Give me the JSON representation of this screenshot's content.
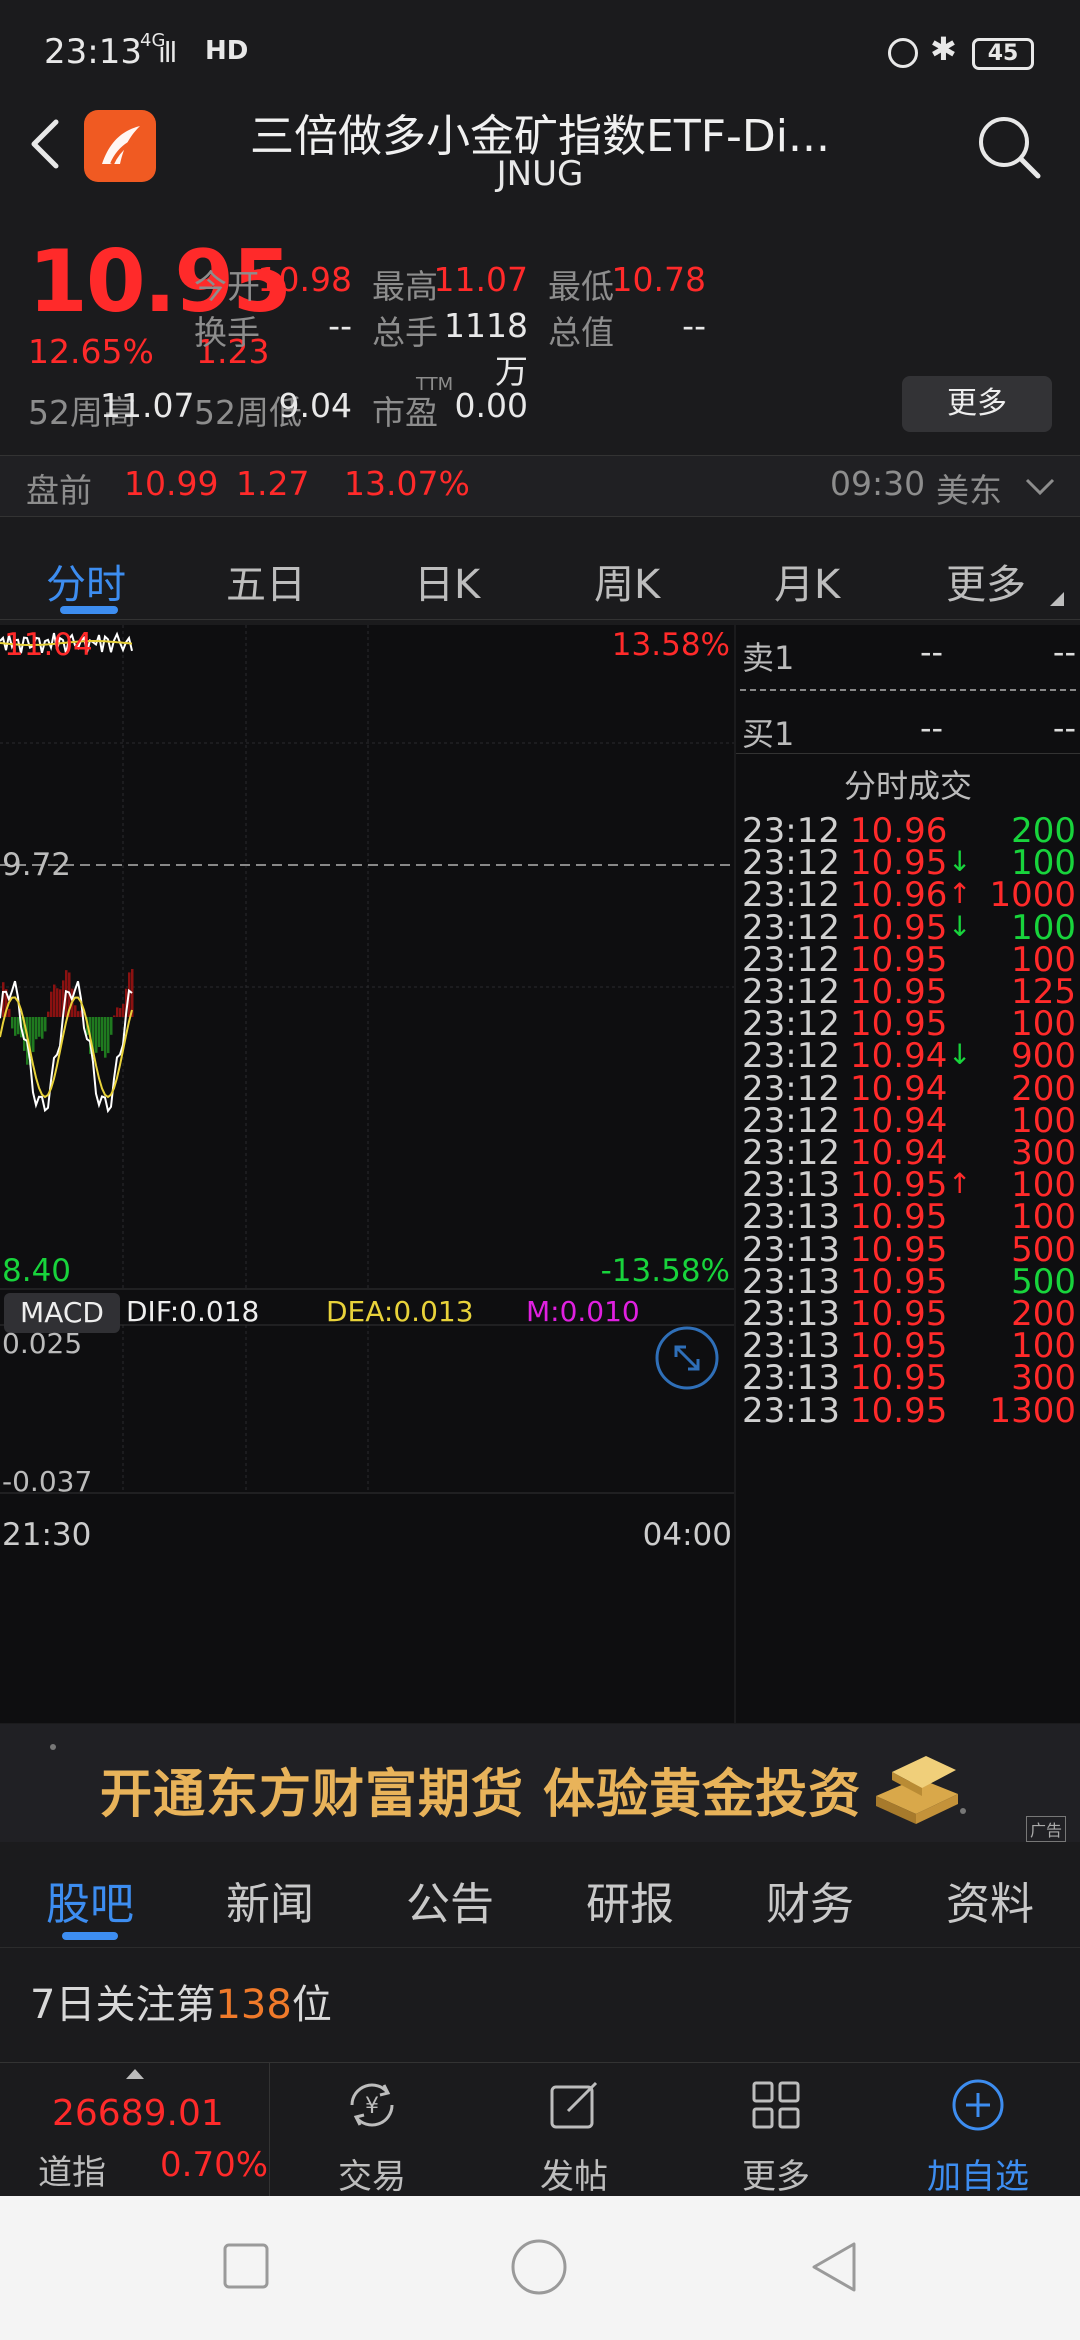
{
  "status_bar": {
    "time": "23:13",
    "network": "4G",
    "signal": "ıll",
    "hd": "HD",
    "battery": "45"
  },
  "header": {
    "title": "三倍做多小金矿指数ETF-Di...",
    "symbol": "JNUG"
  },
  "quote": {
    "price": "10.95",
    "change_pct": "12.65%",
    "change": "1.23",
    "rows": [
      [
        {
          "label": "今开",
          "value": "10.98",
          "color": "#ff2a2a"
        },
        {
          "label": "最高",
          "value": "11.07",
          "color": "#ff2a2a"
        },
        {
          "label": "最低",
          "value": "10.78",
          "color": "#ff2a2a"
        }
      ],
      [
        {
          "label": "换手",
          "value": "--",
          "color": "#e8e8e8"
        },
        {
          "label": "总手",
          "value": "1118万",
          "color": "#e8e8e8"
        },
        {
          "label": "总值",
          "value": "--",
          "color": "#e8e8e8"
        }
      ]
    ],
    "w52_high_label": "52周高",
    "w52_high": "11.07",
    "w52_low_label": "52周低",
    "w52_low": "9.04",
    "pe_label": "市盈",
    "pe_sup": "TTM",
    "pe_value": "0.00",
    "more_label": "更多"
  },
  "premarket": {
    "label": "盘前",
    "price": "10.99",
    "change": "1.27",
    "pct": "13.07%",
    "time": "09:30",
    "market": "美东"
  },
  "chart_tabs": [
    "分时",
    "五日",
    "日K",
    "周K",
    "月K",
    "更多"
  ],
  "chart": {
    "top_left": "11.04",
    "top_right": "13.58%",
    "mid": "9.72",
    "bottom_left": "8.40",
    "bottom_right": "-13.58%",
    "macd_label": "MACD",
    "dif": "DIF:0.018",
    "dea": "DEA:0.013",
    "m": "M:0.010",
    "macd_top": "0.025",
    "macd_bottom": "-0.037",
    "time_start": "21:30",
    "time_end": "04:00"
  },
  "order_book": {
    "sell_label": "卖1",
    "sell_price": "--",
    "sell_vol": "--",
    "buy_label": "买1",
    "buy_price": "--",
    "buy_vol": "--",
    "ticks_title": "分时成交"
  },
  "ticks": [
    {
      "time": "23:12",
      "price": "10.96",
      "arrow": "",
      "vol": "200",
      "vol_color": "#18d43c"
    },
    {
      "time": "23:12",
      "price": "10.95",
      "arrow": "↓",
      "vol": "100",
      "vol_color": "#18d43c"
    },
    {
      "time": "23:12",
      "price": "10.96",
      "arrow": "↑",
      "vol": "1000",
      "vol_color": "#ff2a2a"
    },
    {
      "time": "23:12",
      "price": "10.95",
      "arrow": "↓",
      "vol": "100",
      "vol_color": "#18d43c"
    },
    {
      "time": "23:12",
      "price": "10.95",
      "arrow": "",
      "vol": "100",
      "vol_color": "#ff2a2a"
    },
    {
      "time": "23:12",
      "price": "10.95",
      "arrow": "",
      "vol": "125",
      "vol_color": "#ff2a2a"
    },
    {
      "time": "23:12",
      "price": "10.95",
      "arrow": "",
      "vol": "100",
      "vol_color": "#ff2a2a"
    },
    {
      "time": "23:12",
      "price": "10.94",
      "arrow": "↓",
      "vol": "900",
      "vol_color": "#ff2a2a"
    },
    {
      "time": "23:12",
      "price": "10.94",
      "arrow": "",
      "vol": "200",
      "vol_color": "#ff2a2a"
    },
    {
      "time": "23:12",
      "price": "10.94",
      "arrow": "",
      "vol": "100",
      "vol_color": "#ff2a2a"
    },
    {
      "time": "23:12",
      "price": "10.94",
      "arrow": "",
      "vol": "300",
      "vol_color": "#ff2a2a"
    },
    {
      "time": "23:13",
      "price": "10.95",
      "arrow": "↑",
      "vol": "100",
      "vol_color": "#ff2a2a"
    },
    {
      "time": "23:13",
      "price": "10.95",
      "arrow": "",
      "vol": "100",
      "vol_color": "#ff2a2a"
    },
    {
      "time": "23:13",
      "price": "10.95",
      "arrow": "",
      "vol": "500",
      "vol_color": "#ff2a2a"
    },
    {
      "time": "23:13",
      "price": "10.95",
      "arrow": "",
      "vol": "500",
      "vol_color": "#18d43c"
    },
    {
      "time": "23:13",
      "price": "10.95",
      "arrow": "",
      "vol": "200",
      "vol_color": "#ff2a2a"
    },
    {
      "time": "23:13",
      "price": "10.95",
      "arrow": "",
      "vol": "100",
      "vol_color": "#ff2a2a"
    },
    {
      "time": "23:13",
      "price": "10.95",
      "arrow": "",
      "vol": "300",
      "vol_color": "#ff2a2a"
    },
    {
      "time": "23:13",
      "price": "10.95",
      "arrow": "",
      "vol": "1300",
      "vol_color": "#ff2a2a"
    }
  ],
  "ad": {
    "text": "开通东方财富期货 体验黄金投资",
    "tag": "广告"
  },
  "news_tabs": [
    "股吧",
    "新闻",
    "公告",
    "研报",
    "财务",
    "资料"
  ],
  "attention": {
    "prefix": "7日关注第",
    "rank": "138",
    "suffix": "位"
  },
  "toolbar": {
    "index_value": "26689.01",
    "index_name": "道指",
    "index_pct": "0.70%",
    "trade": "交易",
    "post": "发帖",
    "more": "更多",
    "add_watch": "加自选"
  },
  "colors": {
    "up": "#ff2a2a",
    "down": "#18d43c",
    "accent": "#3d8df0",
    "price_line": "#ffffff",
    "avg_line": "#e8d23a"
  }
}
